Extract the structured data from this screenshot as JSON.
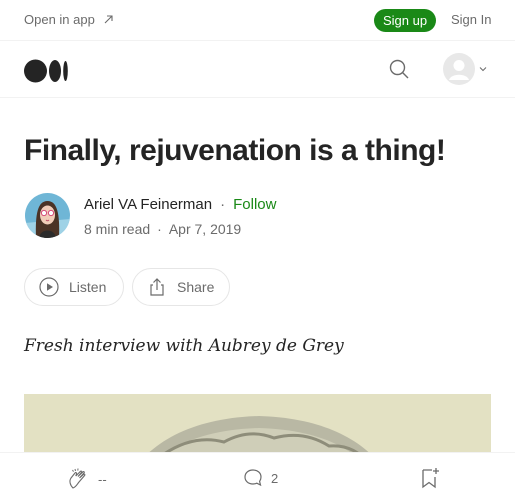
{
  "topbar": {
    "open_in_app": "Open in app",
    "sign_up": "Sign up",
    "sign_in": "Sign In"
  },
  "article": {
    "title": "Finally, rejuvenation is a thing!",
    "author": "Ariel VA Feinerman",
    "separator": "·",
    "follow": "Follow",
    "read_time": "8 min read",
    "date": "Apr 7, 2019",
    "subtitle": "Fresh interview with Aubrey de Grey"
  },
  "actions": {
    "listen": "Listen",
    "share": "Share"
  },
  "bottombar": {
    "claps": "--",
    "responses": "2"
  },
  "colors": {
    "accent_green": "#1a8917",
    "text": "#242424",
    "muted": "#6b6b6b"
  }
}
